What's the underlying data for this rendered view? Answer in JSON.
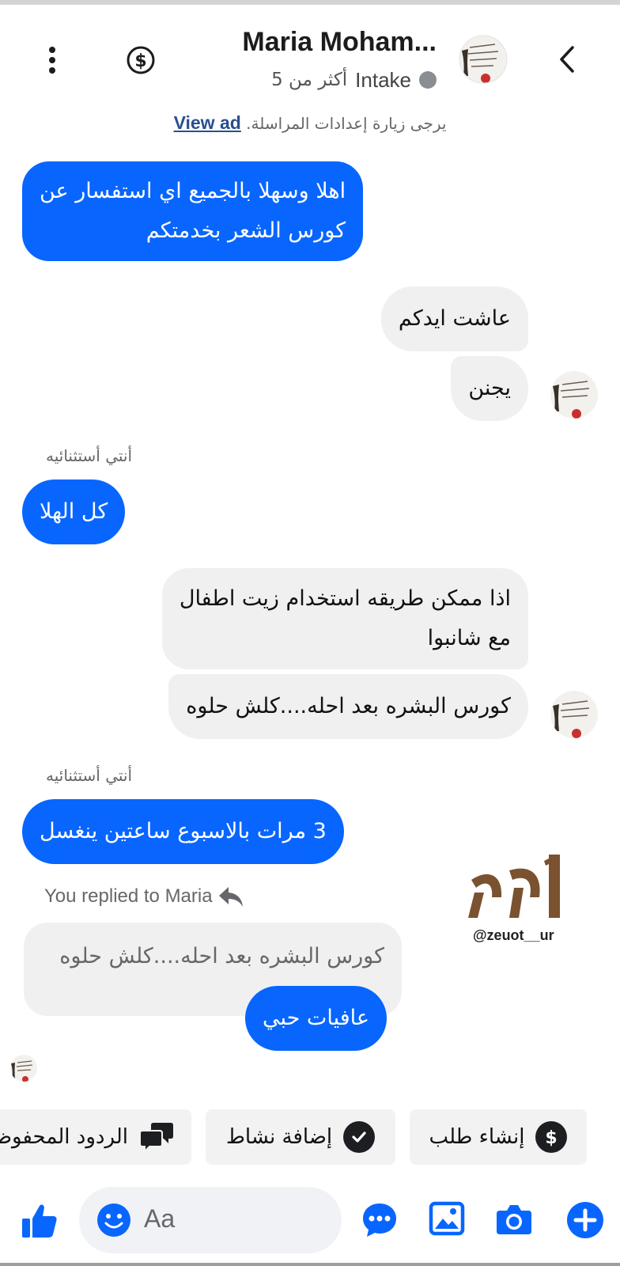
{
  "header": {
    "contact_name": "Maria Moham...",
    "label_tag": "Intake",
    "time_ago": "أكثر من 5",
    "notice_text": "يرجى زيارة إعدادات المراسلة.",
    "view_ad": "View ad"
  },
  "messages": [
    {
      "side": "out",
      "text_lines": [
        "اهلا وسهلا بالجميع اي استفسار عن",
        "كورس الشعر بخدمتكم"
      ]
    },
    {
      "side": "in",
      "text": "عاشت ايدكم"
    },
    {
      "side": "in",
      "text": "يجنن"
    },
    {
      "side": "out",
      "sender": "أنتي أستثنائيه",
      "text": "كل الهلا"
    },
    {
      "side": "in",
      "text_lines": [
        "اذا ممكن طريقه استخدام زيت اطفال",
        "مع شانبوا"
      ]
    },
    {
      "side": "in",
      "text": "كورس البشره بعد احله....كلش حلوه"
    },
    {
      "side": "out",
      "sender": "أنتي أستثنائيه",
      "text": "3 مرات بالاسبوع ساعتين ينغسل"
    }
  ],
  "reply": {
    "replied_label": "You replied to Maria",
    "quoted_text": "كورس البشره بعد احله....كلش حلوه",
    "reply_text": "عافيات حبي"
  },
  "watermark": {
    "handle": "@zeuot__ur"
  },
  "quick_actions": [
    {
      "label": "إنشاء طلب",
      "icon": "dollar-icon"
    },
    {
      "label": "إضافة نشاط",
      "icon": "check-circle-icon"
    },
    {
      "label": "الردود المحفوظة",
      "icon": "chat-bubbles-icon"
    }
  ],
  "composer": {
    "placeholder": "Aa"
  },
  "colors": {
    "messenger_blue": "#0866ff",
    "incoming_bubble": "#f0f0f0",
    "chip_background": "#f2f2f2",
    "watermark_brown": "#7a5230"
  }
}
